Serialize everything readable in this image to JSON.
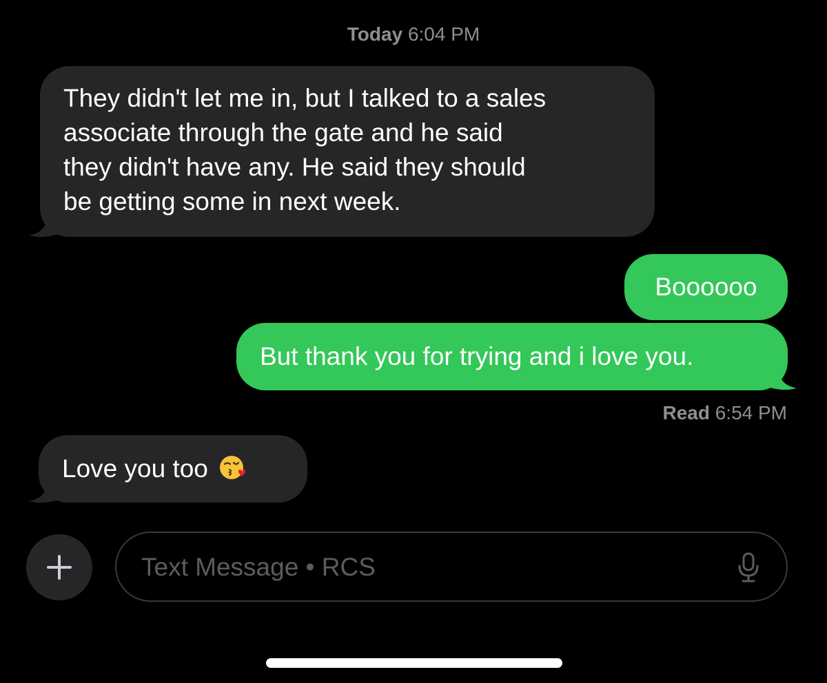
{
  "conversation": {
    "timestamp_day": "Today",
    "timestamp_time": "6:04 PM",
    "messages": [
      {
        "direction": "incoming",
        "lines": [
          "They didn't let me in, but I talked to a sales",
          "associate through the gate and he said",
          "they didn't have any. He said they should",
          "be getting some in next week."
        ]
      },
      {
        "direction": "outgoing",
        "text": "Boooooo"
      },
      {
        "direction": "outgoing",
        "text": "But thank you for trying and i love you."
      },
      {
        "direction": "incoming",
        "text": "Love you too",
        "emoji": "kissing-face-with-heart-emoji"
      }
    ],
    "read_receipt": {
      "label": "Read",
      "time": "6:54 PM"
    }
  },
  "composer": {
    "plus_icon": "plus-icon",
    "placeholder": "Text Message • RCS",
    "mic_icon": "microphone-icon"
  },
  "colors": {
    "background": "#000000",
    "incoming_bubble": "#262628",
    "outgoing_bubble": "#34c759",
    "secondary_text": "#8e8e93"
  }
}
